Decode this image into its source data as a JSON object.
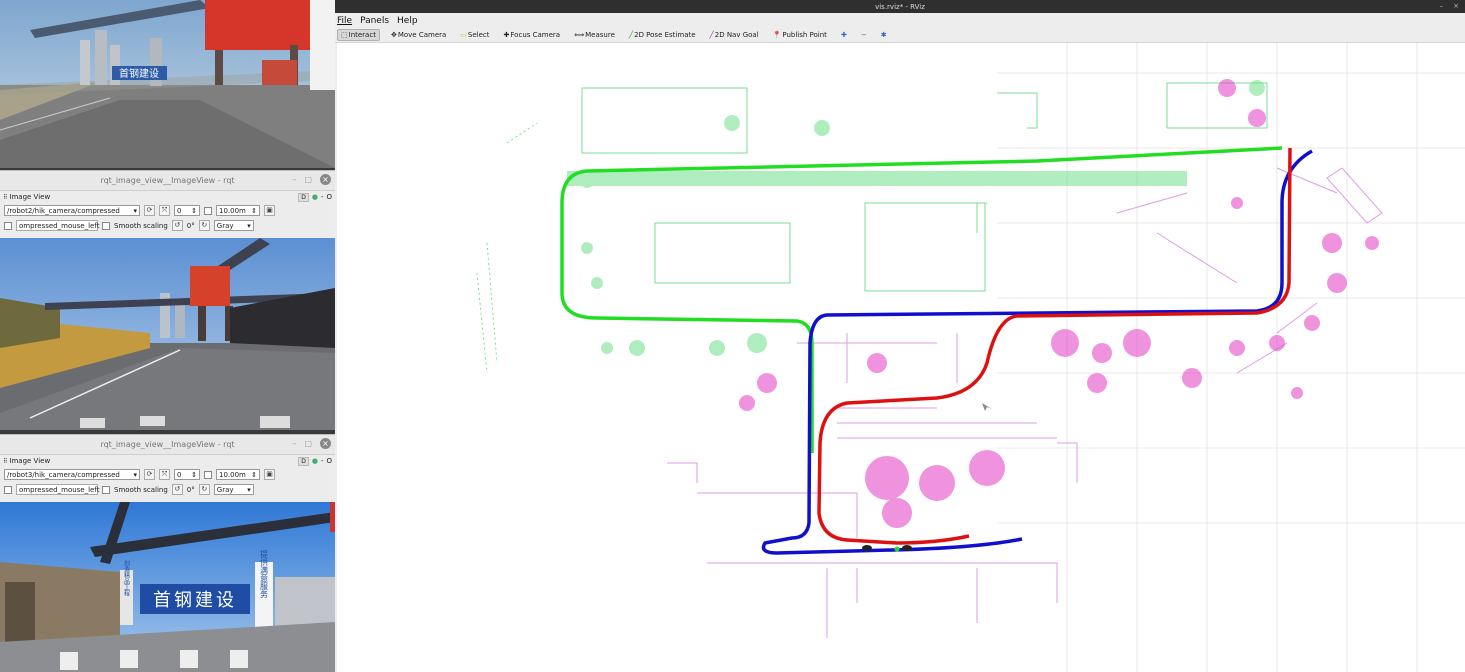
{
  "rqt_windows": [
    {
      "title": "rqt_image_view__ImageView - rqt",
      "plugin_label": "Image View",
      "topic": "/robot2/hik_camera/compressed",
      "spin_value": "0",
      "distance": "10.00m",
      "mouse_topic": "ompressed_mouse_left",
      "smooth_scaling_label": "Smooth scaling",
      "rotation": "0°",
      "color_scheme": "Gray",
      "d_button": "D"
    },
    {
      "title": "rqt_image_view__ImageView - rqt",
      "plugin_label": "Image View",
      "topic": "/robot3/hik_camera/compressed",
      "spin_value": "0",
      "distance": "10.00m",
      "mouse_topic": "ompressed_mouse_left",
      "smooth_scaling_label": "Smooth scaling",
      "rotation": "0°",
      "color_scheme": "Gray",
      "d_button": "D"
    }
  ],
  "camera_feeds": [
    {
      "sign_text": "首钢建设"
    },
    {
      "sign_text": ""
    },
    {
      "sign_text": "首钢建设",
      "side_sign": "提供满意服务",
      "side_sign_left": "创造精品工程"
    }
  ],
  "rviz": {
    "title": "vis.rviz* - RViz",
    "menu": {
      "file": "File",
      "panels": "Panels",
      "help": "Help"
    },
    "tools": [
      {
        "label": "Interact",
        "icon": "interact-icon",
        "active": true
      },
      {
        "label": "Move Camera",
        "icon": "move-camera-icon"
      },
      {
        "label": "Select",
        "icon": "select-icon"
      },
      {
        "label": "Focus Camera",
        "icon": "focus-camera-icon"
      },
      {
        "label": "Measure",
        "icon": "measure-icon"
      },
      {
        "label": "2D Pose Estimate",
        "icon": "pose-estimate-icon"
      },
      {
        "label": "2D Nav Goal",
        "icon": "nav-goal-icon"
      },
      {
        "label": "Publish Point",
        "icon": "publish-point-icon"
      }
    ],
    "path_colors": {
      "green": "#22dd22",
      "blue": "#1010cc",
      "red": "#dd1111"
    }
  }
}
